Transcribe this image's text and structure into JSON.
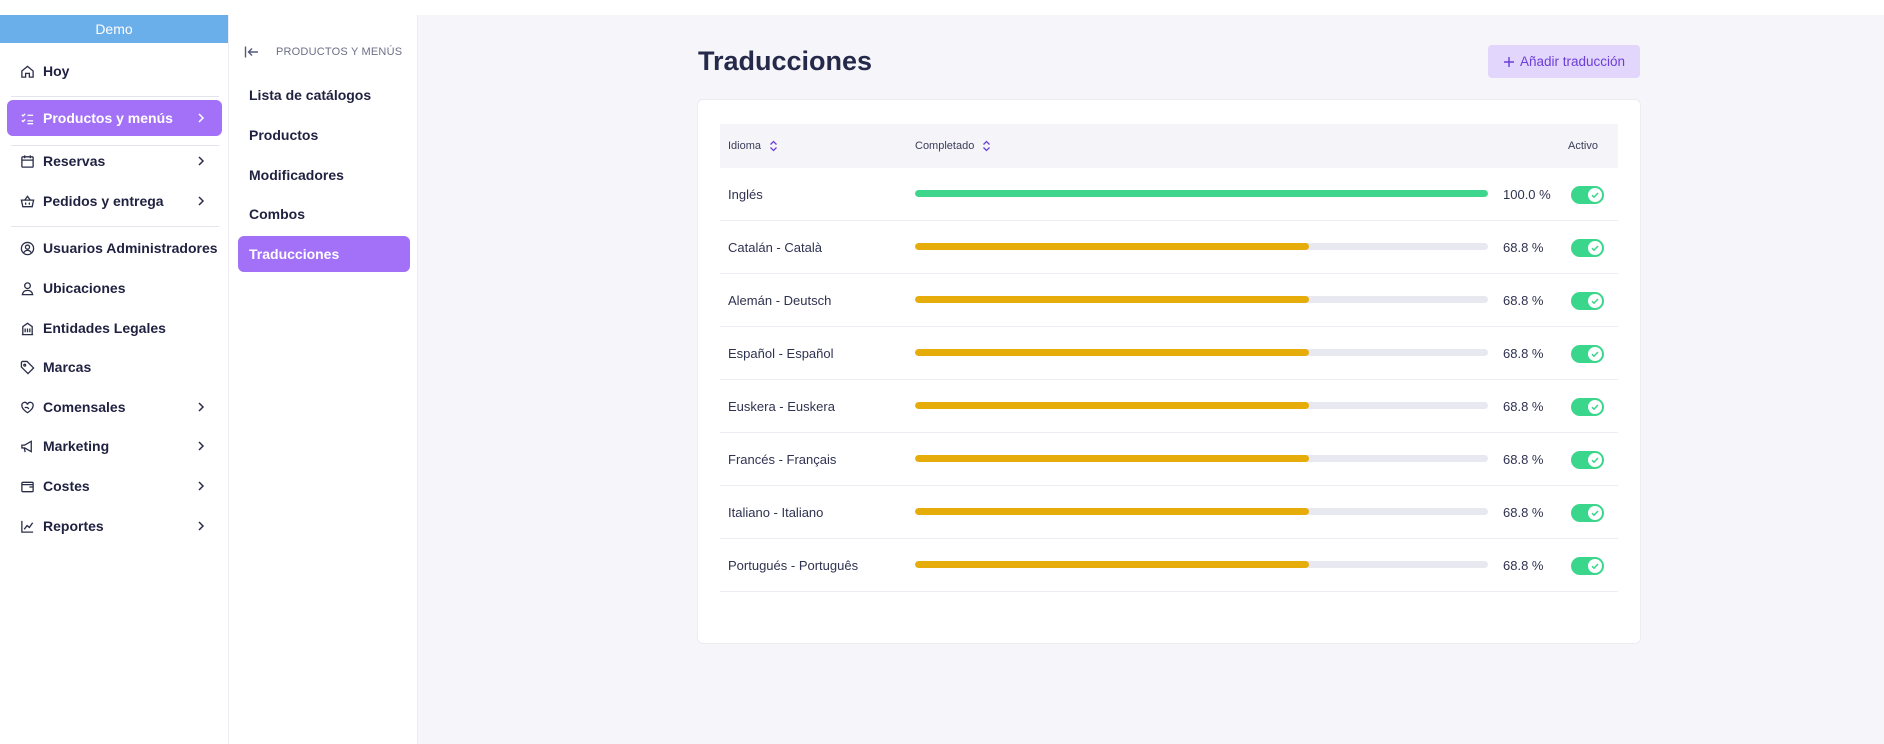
{
  "env_banner": "Demo",
  "colors": {
    "accent": "#a371f7",
    "banner": "#6aaeea",
    "progress_complete": "#3dd68c",
    "progress_partial": "#e6ad0a",
    "toggle_on": "#39d68b"
  },
  "sidebar": {
    "items": [
      {
        "label": "Hoy",
        "icon": "home-icon"
      },
      {
        "label": "Productos y menús",
        "icon": "list-check-icon",
        "active": true
      },
      {
        "label": "Reservas",
        "icon": "calendar-icon"
      },
      {
        "label": "Pedidos y entrega",
        "icon": "basket-icon"
      },
      {
        "label": "Usuarios Administradores",
        "icon": "user-circle-icon"
      },
      {
        "label": "Ubicaciones",
        "icon": "user-location-icon"
      },
      {
        "label": "Entidades Legales",
        "icon": "building-icon"
      },
      {
        "label": "Marcas",
        "icon": "tag-icon"
      },
      {
        "label": "Comensales",
        "icon": "heart-hand-icon"
      },
      {
        "label": "Marketing",
        "icon": "megaphone-icon"
      },
      {
        "label": "Costes",
        "icon": "wallet-icon"
      },
      {
        "label": "Reportes",
        "icon": "chart-icon"
      }
    ]
  },
  "subnav": {
    "header": "PRODUCTOS Y MENÚS",
    "items": [
      {
        "label": "Lista de catálogos"
      },
      {
        "label": "Productos"
      },
      {
        "label": "Modificadores"
      },
      {
        "label": "Combos"
      },
      {
        "label": "Traducciones",
        "active": true
      }
    ]
  },
  "page": {
    "title": "Traducciones",
    "add_button": "Añadir traducción"
  },
  "table": {
    "headers": {
      "language": "Idioma",
      "completed": "Completado",
      "active": "Activo"
    },
    "rows": [
      {
        "language": "Inglés",
        "percent": "100.0 %",
        "progress": 1.0,
        "active": true
      },
      {
        "language": "Catalán - Català",
        "percent": "68.8 %",
        "progress": 0.688,
        "active": true
      },
      {
        "language": "Alemán - Deutsch",
        "percent": "68.8 %",
        "progress": 0.688,
        "active": true
      },
      {
        "language": "Español - Español",
        "percent": "68.8 %",
        "progress": 0.688,
        "active": true
      },
      {
        "language": "Euskera - Euskera",
        "percent": "68.8 %",
        "progress": 0.688,
        "active": true
      },
      {
        "language": "Francés - Français",
        "percent": "68.8 %",
        "progress": 0.688,
        "active": true
      },
      {
        "language": "Italiano - Italiano",
        "percent": "68.8 %",
        "progress": 0.688,
        "active": true
      },
      {
        "language": "Portugués - Português",
        "percent": "68.8 %",
        "progress": 0.688,
        "active": true
      }
    ]
  }
}
